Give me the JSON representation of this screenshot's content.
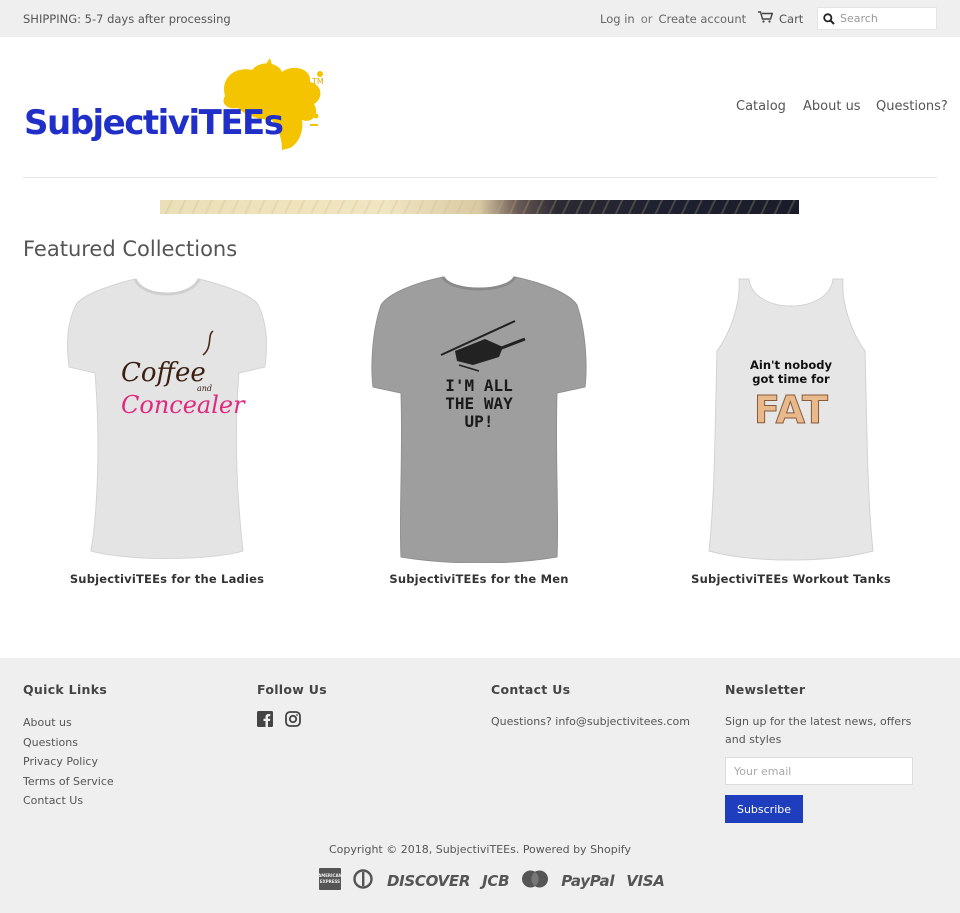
{
  "topbar": {
    "shipping": "SHIPPING: 5-7 days after processing",
    "login": "Log in",
    "or": "or",
    "create_account": "Create account",
    "cart": "Cart",
    "search_placeholder": "Search"
  },
  "header": {
    "logo_text": "SubjectiviTEEs",
    "logo_tm": "TM",
    "nav": [
      "Catalog",
      "About us",
      "Questions?"
    ]
  },
  "featured": {
    "title": "Featured Collections",
    "collections": [
      {
        "title": "SubjectiviTEEs for the Ladies",
        "shirt_text": [
          "Coffee",
          "and",
          "Concealer"
        ]
      },
      {
        "title": "SubjectiviTEEs for the Men",
        "shirt_text": [
          "I'M ALL",
          "THE WAY",
          "UP!"
        ]
      },
      {
        "title": "SubjectiviTEEs Workout Tanks",
        "shirt_text": [
          "Ain't nobody",
          "got time for",
          "FAT"
        ]
      }
    ]
  },
  "footer": {
    "quick_links": {
      "heading": "Quick Links",
      "items": [
        "About us",
        "Questions",
        "Privacy Policy",
        "Terms of Service",
        "Contact Us"
      ]
    },
    "follow": {
      "heading": "Follow Us",
      "icons": [
        "facebook-icon",
        "instagram-icon"
      ]
    },
    "contact": {
      "heading": "Contact Us",
      "text": "Questions? info@subjectivitees.com"
    },
    "newsletter": {
      "heading": "Newsletter",
      "text": "Sign up for the latest news, offers and styles",
      "placeholder": "Your email",
      "button": "Subscribe"
    },
    "copyright": "Copyright © 2018, SubjectiviTEEs. Powered by Shopify",
    "payments": [
      "AMERICAN EXPRESS",
      "Diners Club",
      "DISCOVER",
      "JCB",
      "MasterCard",
      "PayPal",
      "VISA"
    ]
  },
  "colors": {
    "logo_blue": "#1f2fc7",
    "logo_yellow": "#f5c400",
    "subscribe_bg": "#1f3ebd",
    "footer_bg": "#efefef"
  }
}
